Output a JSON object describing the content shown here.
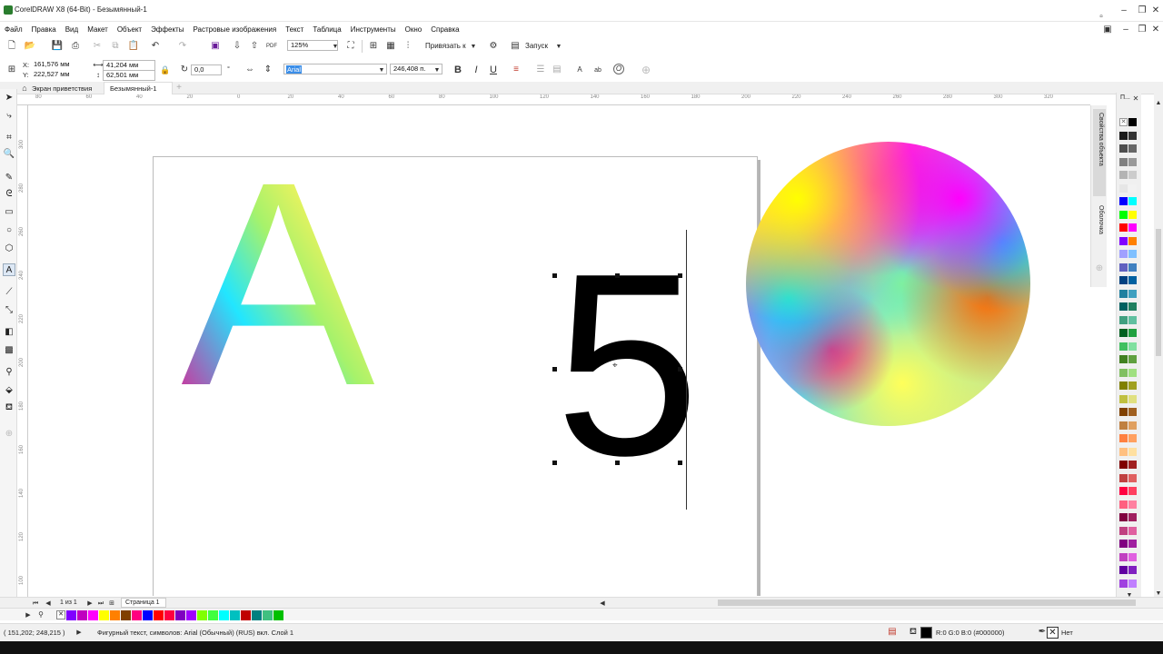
{
  "window": {
    "title": "CorelDRAW X8 (64-Bit) - Безымянный-1"
  },
  "menu": [
    "Файл",
    "Правка",
    "Вид",
    "Макет",
    "Объект",
    "Эффекты",
    "Растровые изображения",
    "Текст",
    "Таблица",
    "Инструменты",
    "Окно",
    "Справка"
  ],
  "toolbar": {
    "zoom": "125%",
    "snap": "Привязать к",
    "launch": "Запуск"
  },
  "propbar": {
    "x": "161,576 мм",
    "y": "222,527 мм",
    "w": "41,204 мм",
    "h": "62,501 мм",
    "x_label": "X:",
    "y_label": "Y:",
    "angle": "0,0",
    "angle_unit": "°",
    "font": "Arial",
    "size": "246,408 п.",
    "bold": "B",
    "italic": "I",
    "underline": "U"
  },
  "tabs": [
    "Экран приветствия",
    "Безымянный-1"
  ],
  "ruler_top": [
    "80",
    "60",
    "40",
    "20",
    "0",
    "20",
    "40",
    "60",
    "80",
    "100",
    "120",
    "140",
    "160",
    "180",
    "200",
    "220",
    "240",
    "260",
    "280",
    "300",
    "320"
  ],
  "ruler_left": [
    "300",
    "280",
    "260",
    "240",
    "220",
    "200",
    "180",
    "160",
    "140",
    "120",
    "100"
  ],
  "canvas": {
    "glyph_a": "A",
    "glyph_5": "5"
  },
  "docker": {
    "title": "П...",
    "tab1": "Свойства объекта",
    "tab2": "Оболочка"
  },
  "pagebar": {
    "counter": "1 из 1",
    "page": "Страница 1"
  },
  "status": {
    "coords": "( 151,202; 248,215 )",
    "info": "Фигурный текст, символов: Arial (Обычный) (RUS) вкл. Слой 1",
    "fill": "R:0 G:0 B:0 (#000000)",
    "outline": "Нет"
  },
  "colors": {
    "accent": "#0078d7",
    "ui_bg": "#f0f0f0",
    "font_highlight": "#3b8ee8"
  },
  "palette_colors": [
    "#ffffff",
    "#000000",
    "#1a1a1a",
    "#333333",
    "#4d4d4d",
    "#666666",
    "#808080",
    "#999999",
    "#b3b3b3",
    "#cccccc",
    "#e6e6e6",
    "#f2f2f2",
    "#0000ff",
    "#00ffff",
    "#00ff00",
    "#ffff00",
    "#ff0000",
    "#ff00ff",
    "#8000ff",
    "#ff8000",
    "#a0a0ff",
    "#80c0ff",
    "#6060c0",
    "#4080c0",
    "#004080",
    "#0060a0",
    "#2080a0",
    "#40a0c0",
    "#006060",
    "#208060",
    "#40a080",
    "#60c0a0",
    "#006020",
    "#20a040",
    "#40c060",
    "#80e0a0",
    "#408020",
    "#60a040",
    "#80c060",
    "#a0e080",
    "#808000",
    "#a0a020",
    "#c0c040",
    "#e0e080",
    "#804000",
    "#a06020",
    "#c08040",
    "#e0a060",
    "#ff8040",
    "#ffa060",
    "#ffc080",
    "#ffe0a0",
    "#800000",
    "#a02020",
    "#c04040",
    "#e06060",
    "#ff0040",
    "#ff4060",
    "#ff6080",
    "#ff80a0",
    "#800040",
    "#a02060",
    "#c04080",
    "#e060a0",
    "#800080",
    "#a020a0",
    "#c040c0",
    "#e060e0",
    "#6000a0",
    "#8020c0",
    "#a040e0",
    "#c080ff"
  ],
  "doc_palette": [
    "#8000ff",
    "#c000c0",
    "#ff00ff",
    "#ffff00",
    "#ff8000",
    "#804000",
    "#ff0080",
    "#0000ff",
    "#ff0000",
    "#ff0040",
    "#8000c0",
    "#a000ff",
    "#80ff00",
    "#40ff40",
    "#00ffff",
    "#00c0c0",
    "#c00000",
    "#008080",
    "#40c080",
    "#00c000"
  ]
}
